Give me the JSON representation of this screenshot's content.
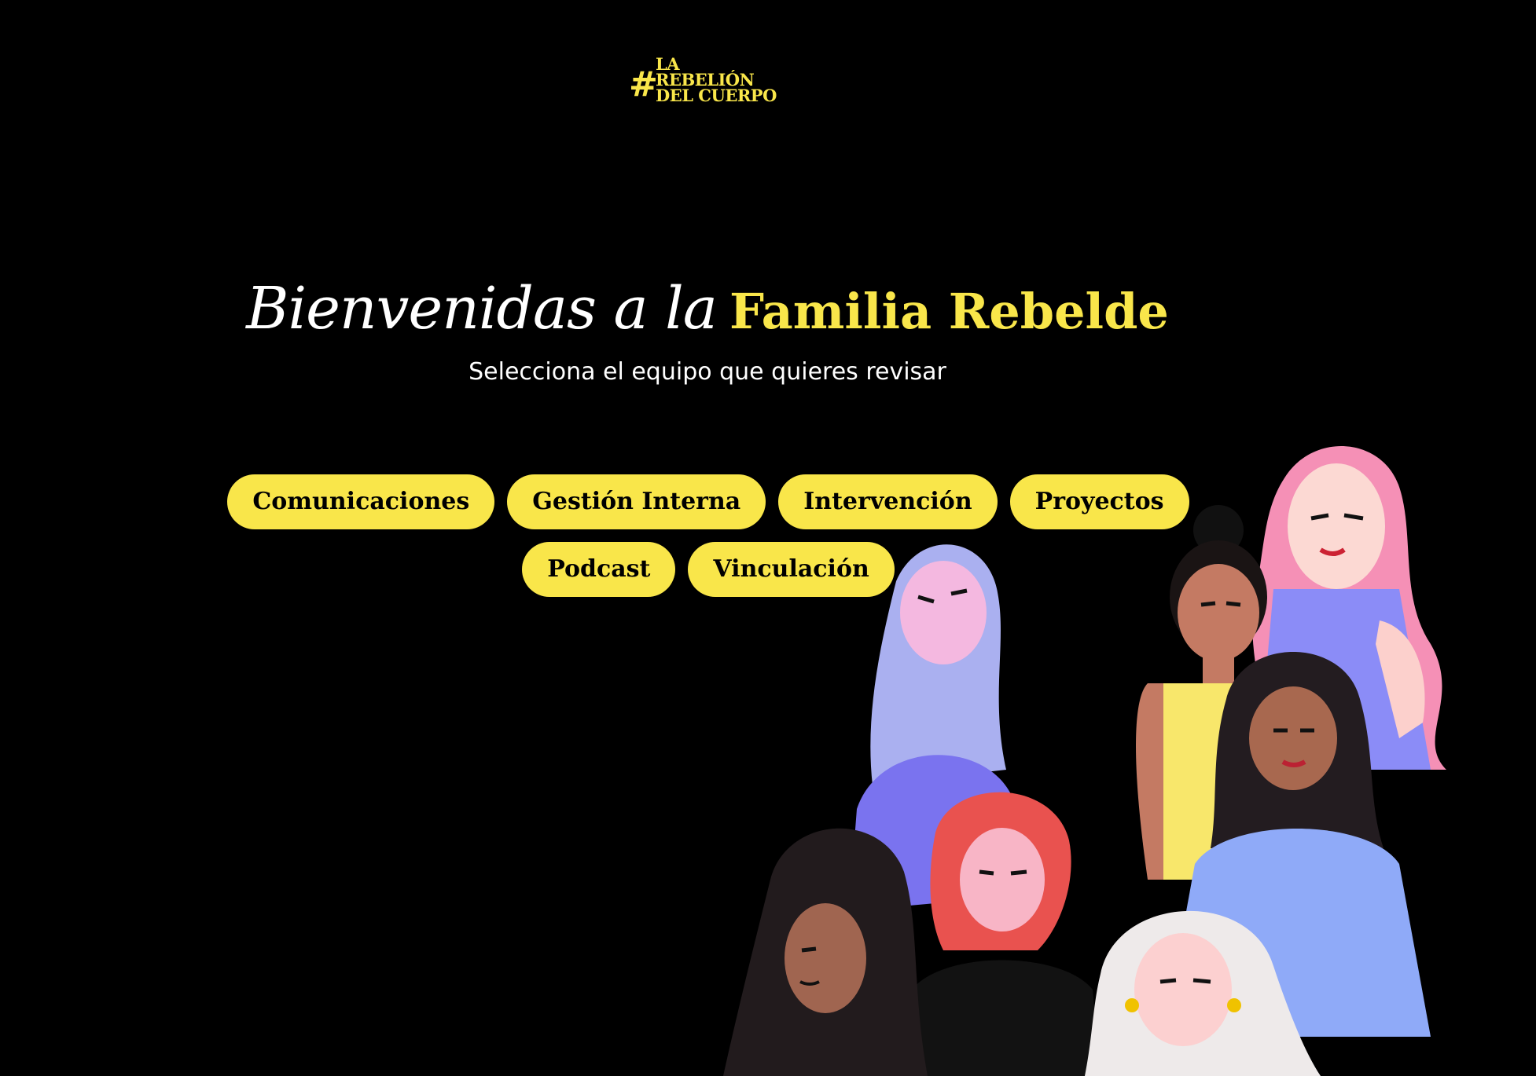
{
  "logo": {
    "hash": "#",
    "line1": "LA",
    "line2": "REBELIÓN",
    "line3": "DEL CUERPO"
  },
  "heading": {
    "script_part": "Bienvenidas a la",
    "bold_part": "Familia Rebelde"
  },
  "subtitle": "Selecciona el equipo que quieres revisar",
  "buttons": [
    "Comunicaciones",
    "Gestión Interna",
    "Intervención",
    "Proyectos",
    "Podcast",
    "Vinculación"
  ],
  "colors": {
    "background": "#000000",
    "accent": "#f9e64a",
    "text": "#ffffff"
  },
  "illustration": "group-of-women-illustration"
}
